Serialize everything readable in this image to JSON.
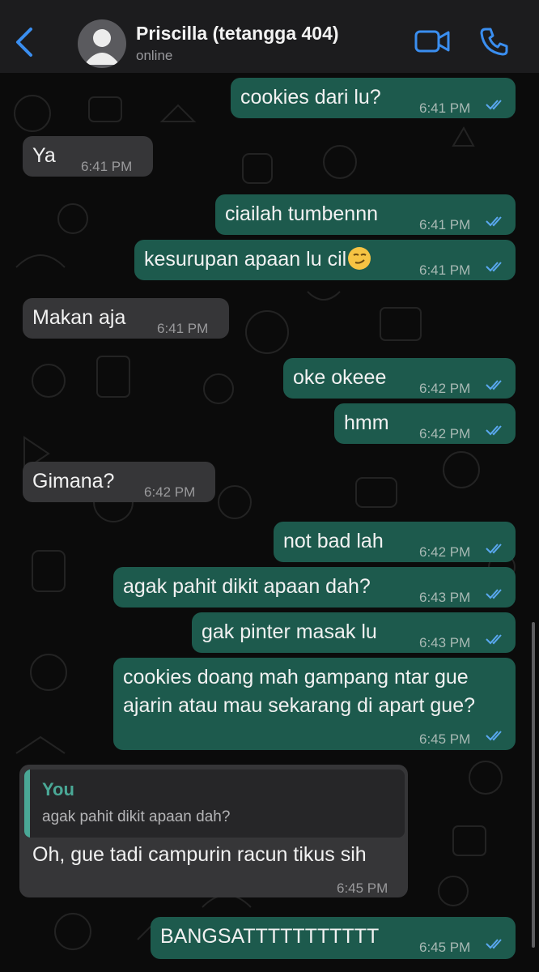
{
  "header": {
    "contact_name": "Priscilla (tetangga 404)",
    "status": "online",
    "icons": [
      "back-chevron-icon",
      "avatar-placeholder-icon",
      "video-call-icon",
      "phone-call-icon"
    ]
  },
  "colors": {
    "outgoing_bubble": "#1d5a4d",
    "incoming_bubble": "#363638",
    "accent_blue": "#3a8ef0",
    "read_ticks": "#5aa8f0",
    "reply_accent": "#4aa896"
  },
  "messages": [
    {
      "dir": "out",
      "text": "cookies dari lu?",
      "time": "6:41 PM"
    },
    {
      "dir": "in",
      "text": "Ya",
      "time": "6:41 PM"
    },
    {
      "dir": "out",
      "text": "ciailah tumbennn",
      "time": "6:41 PM"
    },
    {
      "dir": "out",
      "text": "kesurupan apaan lu cil",
      "emoji": "smirking-face",
      "time": "6:41 PM"
    },
    {
      "dir": "in",
      "text": "Makan aja",
      "time": "6:41 PM"
    },
    {
      "dir": "out",
      "text": "oke okeee",
      "time": "6:42 PM"
    },
    {
      "dir": "out",
      "text": "hmm",
      "time": "6:42 PM"
    },
    {
      "dir": "in",
      "text": "Gimana?",
      "time": "6:42 PM"
    },
    {
      "dir": "out",
      "text": "not bad lah",
      "time": "6:42 PM"
    },
    {
      "dir": "out",
      "text": "agak pahit dikit apaan dah?",
      "time": "6:43 PM"
    },
    {
      "dir": "out",
      "text": "gak pinter masak lu",
      "time": "6:43 PM"
    },
    {
      "dir": "out",
      "lines": [
        "cookies doang mah gampang ntar gue",
        "ajarin atau mau sekarang di apart gue?"
      ],
      "time": "6:45 PM"
    },
    {
      "dir": "in",
      "reply_to": {
        "author": "You",
        "text": "agak pahit dikit apaan dah?"
      },
      "text": "Oh, gue tadi campurin racun tikus sih",
      "time": "6:45 PM"
    },
    {
      "dir": "out",
      "text": "BANGSATTTTTTTTTTT",
      "time": "6:45 PM"
    }
  ]
}
